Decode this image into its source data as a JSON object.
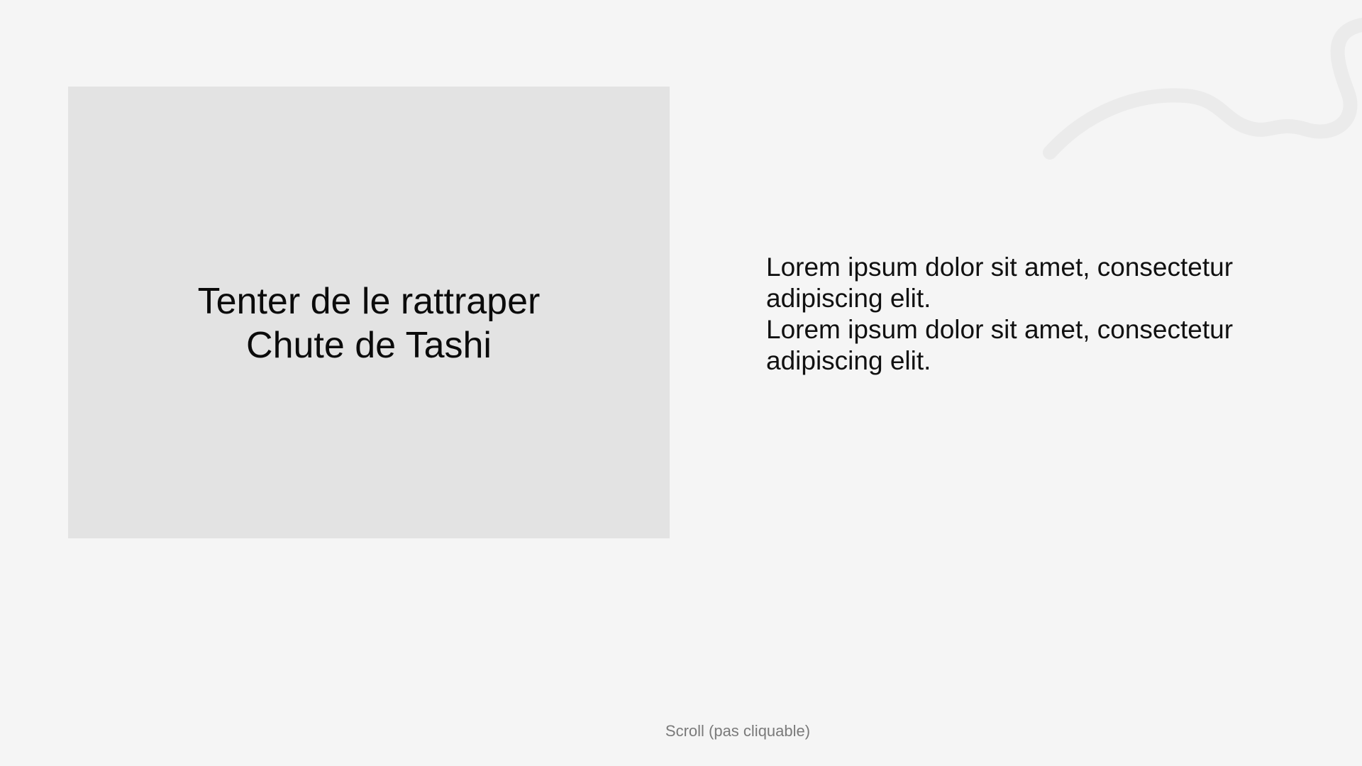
{
  "media": {
    "caption_line1": "Tenter de le rattraper",
    "caption_line2": "Chute de Tashi"
  },
  "content": {
    "paragraphs": [
      "Lorem ipsum dolor sit amet, consectetur adipiscing elit.",
      "Lorem ipsum dolor sit amet, consectetur adipiscing elit."
    ]
  },
  "footer": {
    "scroll_hint": "Scroll (pas cliquable)"
  },
  "colors": {
    "background": "#f5f5f5",
    "panel": "#e3e3e3",
    "text": "#111111",
    "hint": "#7a7a7a",
    "decoration": "#ebebeb"
  },
  "icons": {
    "decoration": "squiggle-line"
  }
}
